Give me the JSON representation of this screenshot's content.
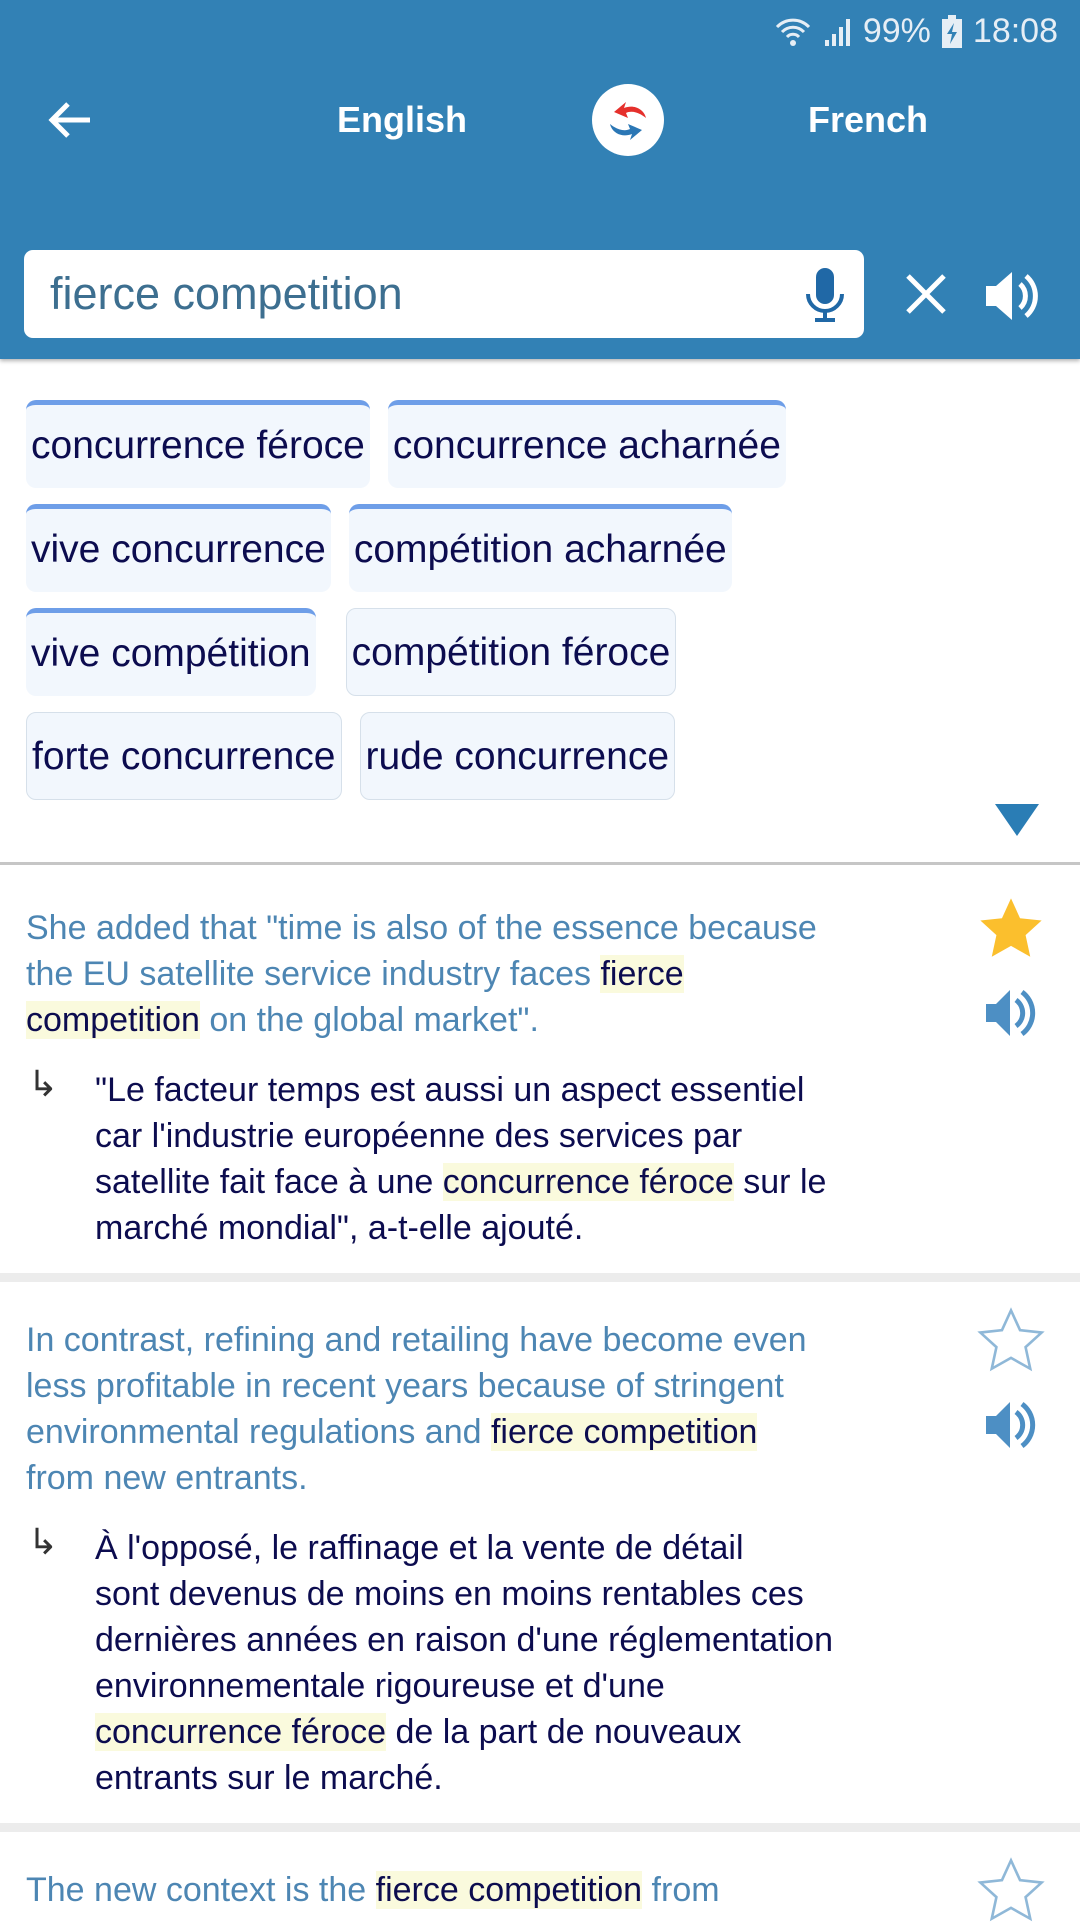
{
  "status_bar": {
    "battery": "99%",
    "time": "18:08"
  },
  "header": {
    "source_language": "English",
    "target_language": "French",
    "search_value": "fierce competition"
  },
  "colors": {
    "header": "#3281b5",
    "source_text": "#4d86b3",
    "target_text": "#0c0c4f",
    "highlight": "#fafadd",
    "star_active": "#fbbf2d"
  },
  "translations": [
    {
      "label": "concurrence féroce",
      "top_rank": true
    },
    {
      "label": "concurrence acharnée",
      "top_rank": true
    },
    {
      "label": "vive concurrence",
      "top_rank": true
    },
    {
      "label": "compétition acharnée",
      "top_rank": true
    },
    {
      "label": "vive compétition",
      "top_rank": true
    },
    {
      "label": "compétition féroce",
      "top_rank": false
    },
    {
      "label": "forte concurrence",
      "top_rank": false
    },
    {
      "label": "rude concurrence",
      "top_rank": false
    }
  ],
  "examples": [
    {
      "starred": true,
      "source": [
        [
          {
            "t": "She added that \"time is also of the essence because",
            "h": false
          }
        ],
        [
          {
            "t": "the EU satellite service industry faces ",
            "h": false
          },
          {
            "t": "fierce",
            "h": true
          }
        ],
        [
          {
            "t": "competition",
            "h": true
          },
          {
            "t": " on the global market\".",
            "h": false
          }
        ]
      ],
      "target": [
        [
          {
            "t": "\"Le facteur temps est aussi un aspect essentiel",
            "h": false
          }
        ],
        [
          {
            "t": "car l'industrie européenne des services par",
            "h": false
          }
        ],
        [
          {
            "t": "satellite fait face à une ",
            "h": false
          },
          {
            "t": "concurrence féroce",
            "h": true
          },
          {
            "t": " sur le",
            "h": false
          }
        ],
        [
          {
            "t": "marché mondial\", a-t-elle ajouté.",
            "h": false
          }
        ]
      ]
    },
    {
      "starred": false,
      "source": [
        [
          {
            "t": "In contrast, refining and retailing have become even",
            "h": false
          }
        ],
        [
          {
            "t": "less profitable in recent years because of stringent",
            "h": false
          }
        ],
        [
          {
            "t": "environmental regulations and ",
            "h": false
          },
          {
            "t": "fierce competition",
            "h": true
          }
        ],
        [
          {
            "t": "from new entrants.",
            "h": false
          }
        ]
      ],
      "target": [
        [
          {
            "t": "À l'opposé, le raffinage et la vente de détail",
            "h": false
          }
        ],
        [
          {
            "t": "sont devenus de moins en moins rentables ces",
            "h": false
          }
        ],
        [
          {
            "t": "dernières années en raison d'une réglementation",
            "h": false
          }
        ],
        [
          {
            "t": "environnementale rigoureuse et d'une",
            "h": false
          }
        ],
        [
          {
            "t": "concurrence féroce",
            "h": true
          },
          {
            "t": " de la part de nouveaux",
            "h": false
          }
        ],
        [
          {
            "t": "entrants sur le marché.",
            "h": false
          }
        ]
      ]
    },
    {
      "starred": false,
      "source": [
        [
          {
            "t": "The new context is the ",
            "h": false
          },
          {
            "t": "fierce competition",
            "h": true
          },
          {
            "t": " from",
            "h": false
          }
        ]
      ],
      "target": []
    }
  ]
}
